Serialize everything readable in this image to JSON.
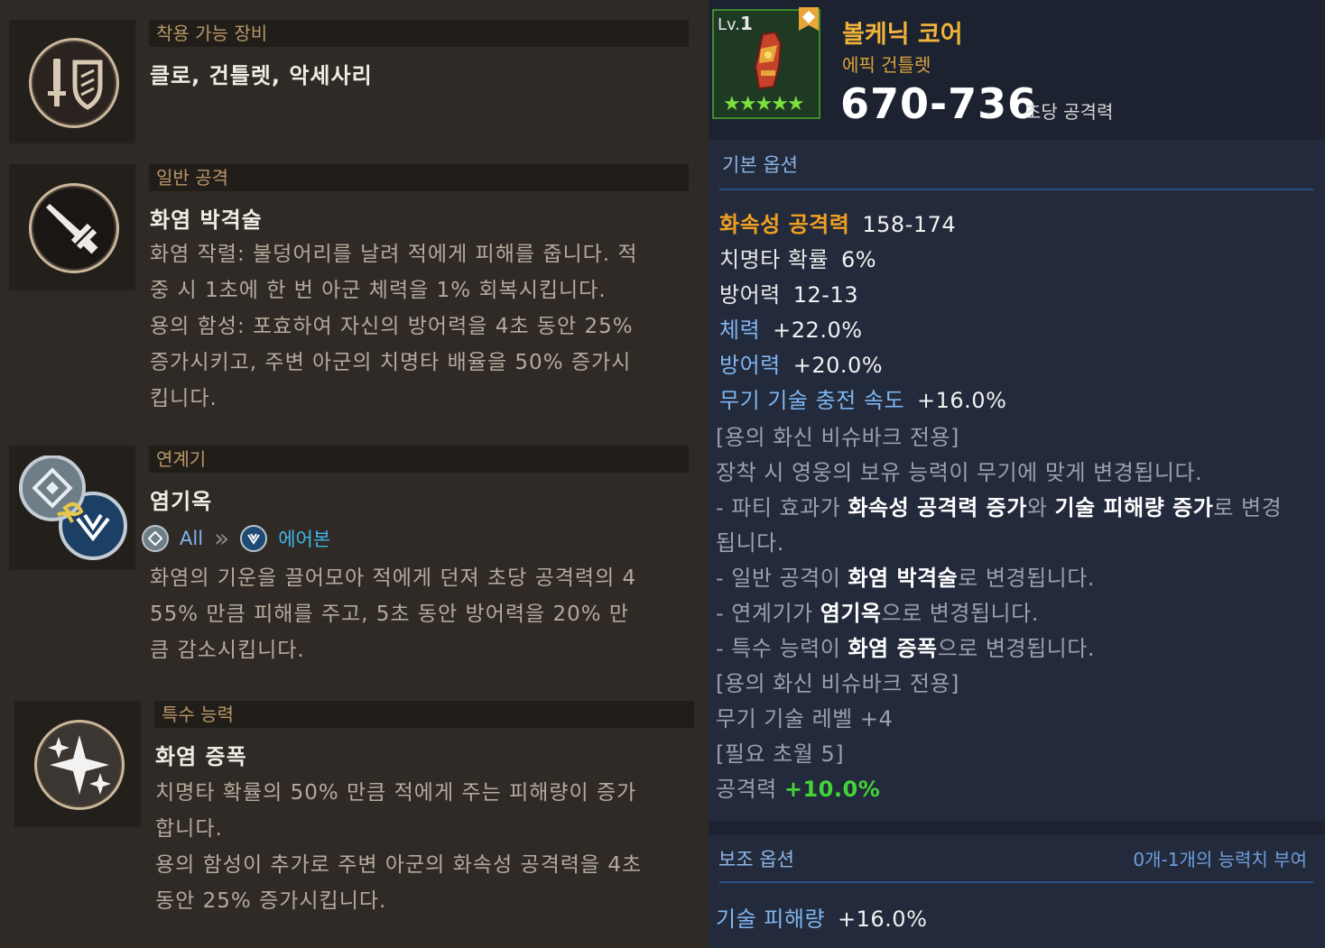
{
  "left": {
    "equip": {
      "header": "착용 가능 장비",
      "text": "클로, 건틀렛, 악세사리"
    },
    "normal_attack": {
      "header": "일반 공격",
      "title": "화염 박격술",
      "lines": [
        "화염 작렬: 불덩어리를 날려 적에게 피해를 줍니다. 적",
        "중 시 1초에 한 번 아군 체력을 1% 회복시킵니다.",
        "용의 함성: 포효하여 자신의 방어력을 4초 동안 25%",
        "증가시키고, 주변 아군의 치명타 배율을 50% 증가시",
        "킵니다."
      ]
    },
    "combo": {
      "header": "연계기",
      "title": "염기옥",
      "from_label": "All",
      "arrow": "»",
      "to_label": "에어본",
      "lines": [
        "화염의 기운을 끌어모아 적에게 던져 초당 공격력의 4",
        "55% 만큼 피해를 주고, 5초 동안 방어력을 20% 만",
        "큼 감소시킵니다."
      ]
    },
    "special": {
      "header": "특수 능력",
      "title": "화염 증폭",
      "lines": [
        "치명타 확률의 50% 만큼 적에게 주는 피해량이 증가",
        "합니다.",
        "용의 함성이 추가로 주변 아군의 화속성 공격력을 4초",
        "동안 25% 증가시킵니다."
      ]
    }
  },
  "item": {
    "lv_prefix": "Lv.",
    "lv": "1",
    "name": "볼케닉 코어",
    "type": "에픽 건틀렛",
    "damage": "670-736",
    "damage_label": "초당 공격력",
    "stars": "★★★★★"
  },
  "basic": {
    "title": "기본 옵션",
    "stats": [
      {
        "name": "화속성 공격력",
        "value": "158-174",
        "color": "#f0a020"
      },
      {
        "name": "치명타 확률",
        "value": "6%",
        "color": "#e8e8e8"
      },
      {
        "name": "방어력",
        "value": "12-13",
        "color": "#e8e8e8"
      },
      {
        "name": "체력",
        "value": "+22.0%",
        "color": "#7fb4ef"
      },
      {
        "name": "방어력",
        "value": "+20.0%",
        "color": "#7fb4ef"
      },
      {
        "name": "무기 기술 충전 속도",
        "value": "+16.0%",
        "color": "#7fb4ef"
      }
    ],
    "text": {
      "l1": "[용의 화신 비슈바크 전용]",
      "l2": "장착 시 영웅의 보유 능력이 무기에 맞게 변경됩니다.",
      "l3a": "- 파티 효과가 ",
      "l3b": "화속성 공격력 증가",
      "l3c": "와 ",
      "l3d": "기술 피해량 증가",
      "l3e": "로 변경",
      "l4": "됩니다.",
      "l5a": "- 일반 공격이 ",
      "l5b": "화염 박격술",
      "l5c": "로 변경됩니다.",
      "l6a": "- 연계기가 ",
      "l6b": "염기옥",
      "l6c": "으로 변경됩니다.",
      "l7a": "- 특수 능력이 ",
      "l7b": "화염 증폭",
      "l7c": "으로 변경됩니다.",
      "l8": "[용의 화신 비슈바크 전용]",
      "l9": "무기 기술 레벨 +4",
      "l10": "[필요 초월 5]",
      "l11a": "공격력 ",
      "l11b": "+10.0%"
    }
  },
  "sub": {
    "title": "보조 옵션",
    "note": "0개-1개의 능력치 부여",
    "stat_name": "기술 피해량",
    "stat_value": "+16.0%",
    "stat_color": "#7fb4ef"
  }
}
